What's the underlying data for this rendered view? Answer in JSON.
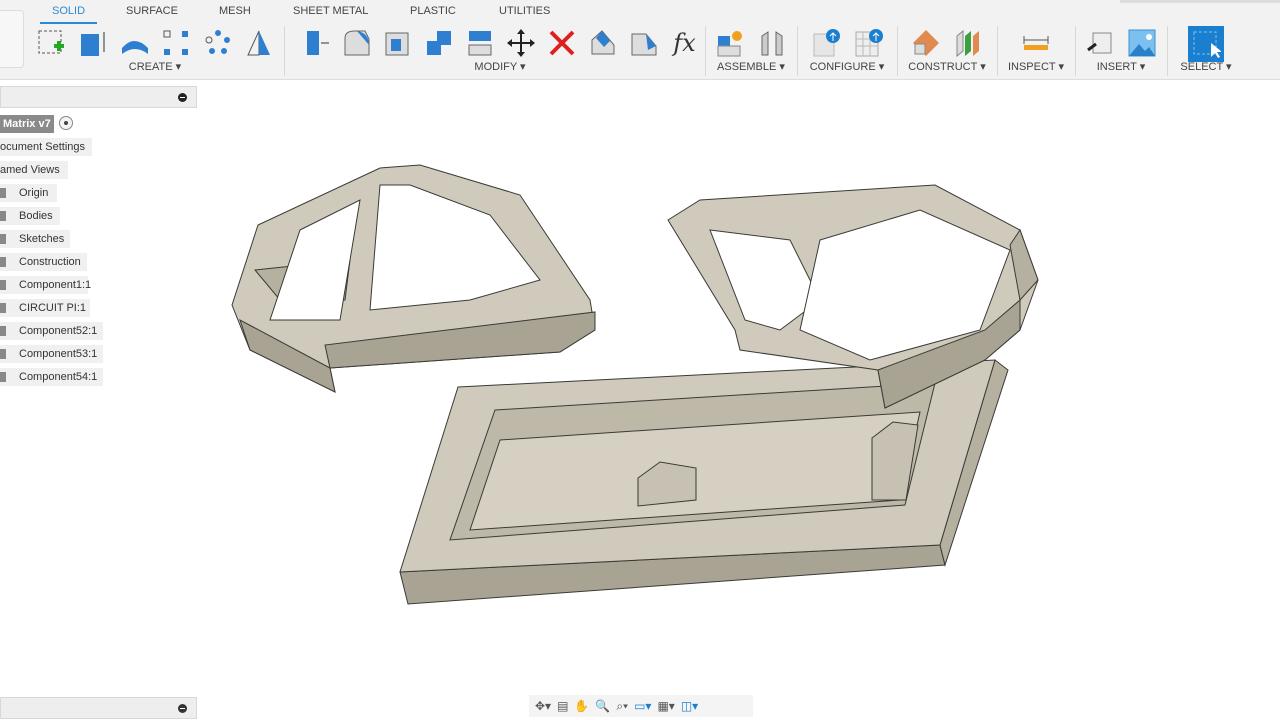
{
  "tabs": [
    "SOLID",
    "SURFACE",
    "MESH",
    "SHEET METAL",
    "PLASTIC",
    "UTILITIES"
  ],
  "active_tab": "SOLID",
  "groups": {
    "create": "CREATE ▾",
    "modify": "MODIFY ▾",
    "assemble": "ASSEMBLE ▾",
    "configure": "CONFIGURE ▾",
    "construct": "CONSTRUCT ▾",
    "inspect": "INSPECT ▾",
    "insert": "INSERT ▾",
    "select": "SELECT ▾"
  },
  "modify_fx": "fx",
  "browser": {
    "root": "Matrix v7",
    "items": [
      "ocument Settings",
      "amed Views",
      "Origin",
      "Bodies",
      "Sketches",
      "Construction",
      "Component1:1",
      "CIRCUIT PI:1",
      "Component52:1",
      "Component53:1",
      "Component54:1"
    ]
  },
  "colors": {
    "accent": "#2b8ad6",
    "model": "#cfcabb",
    "delete": "#e02020"
  }
}
